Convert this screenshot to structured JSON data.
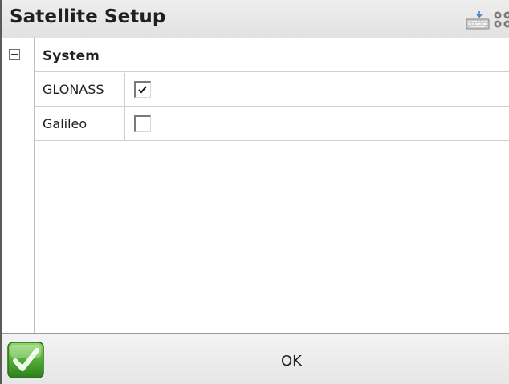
{
  "window": {
    "title": "Satellite Setup"
  },
  "toolbar": {
    "keyboard_icon": "keyboard-icon",
    "settings_icon": "settings-icon"
  },
  "grid": {
    "group": {
      "label": "System",
      "expanded": true
    },
    "rows": [
      {
        "label": "GLONASS",
        "checked": true
      },
      {
        "label": "Galileo",
        "checked": false
      }
    ]
  },
  "footer": {
    "ok_label": "OK",
    "accent_color": "#3f9a2a"
  }
}
